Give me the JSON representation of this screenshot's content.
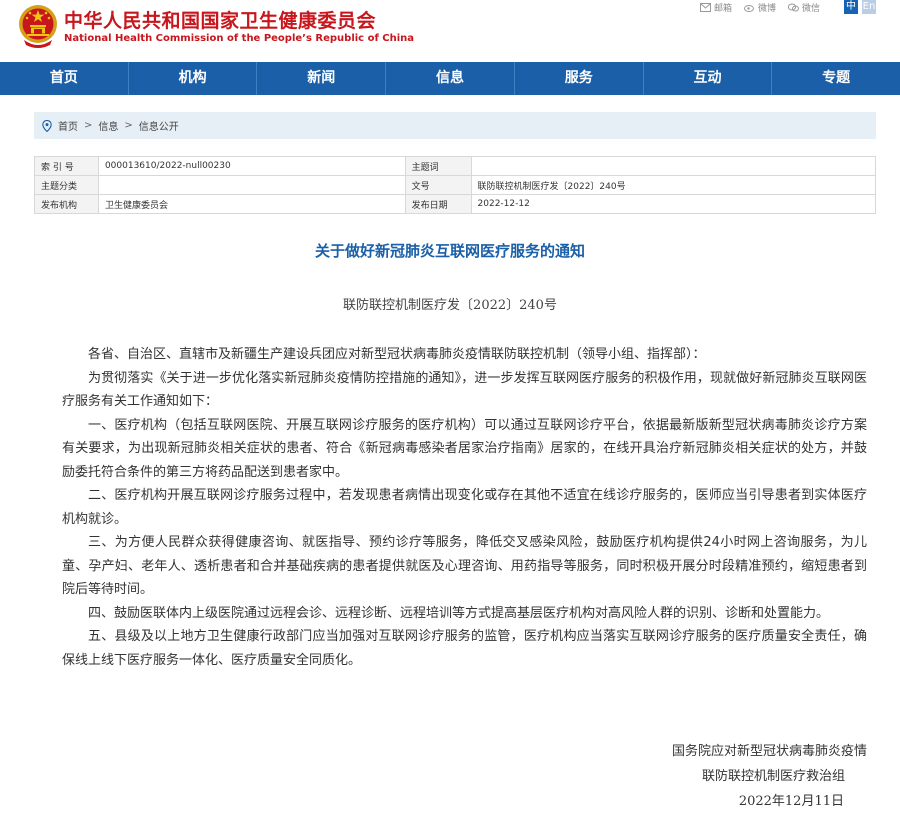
{
  "header": {
    "title_cn": "中华人民共和国国家卫生健康委员会",
    "title_en": "National Health Commission of the People’s Republic of China",
    "top_links": [
      {
        "icon": "mail-icon",
        "label": "邮箱"
      },
      {
        "icon": "weibo-icon",
        "label": "微博"
      },
      {
        "icon": "wechat-icon",
        "label": "微信"
      }
    ],
    "lang_zh": "中",
    "lang_en": "En"
  },
  "nav": {
    "items": [
      "首页",
      "机构",
      "新闻",
      "信息",
      "服务",
      "互动",
      "专题"
    ]
  },
  "breadcrumb": {
    "items": [
      "首页",
      "信息",
      "信息公开"
    ],
    "separator": ">"
  },
  "meta": {
    "index_label": "索 引 号",
    "index_value": "000013610/2022-null00230",
    "subject_label": "主题词",
    "subject_value": "",
    "category_label": "主题分类",
    "category_value": "",
    "docno_label": "文号",
    "docno_value": "联防联控机制医疗发〔2022〕240号",
    "issuer_label": "发布机构",
    "issuer_value": "卫生健康委员会",
    "date_label": "发布日期",
    "date_value": "2022-12-12"
  },
  "document": {
    "title": "关于做好新冠肺炎互联网医疗服务的通知",
    "number": "联防联控机制医疗发〔2022〕240号",
    "paragraphs": [
      "各省、自治区、直辖市及新疆生产建设兵团应对新型冠状病毒肺炎疫情联防联控机制（领导小组、指挥部）：",
      "为贯彻落实《关于进一步优化落实新冠肺炎疫情防控措施的通知》，进一步发挥互联网医疗服务的积极作用，现就做好新冠肺炎互联网医疗服务有关工作通知如下：",
      "一、医疗机构（包括互联网医院、开展互联网诊疗服务的医疗机构）可以通过互联网诊疗平台，依据最新版新型冠状病毒肺炎诊疗方案有关要求，为出现新冠肺炎相关症状的患者、符合《新冠病毒感染者居家治疗指南》居家的，在线开具治疗新冠肺炎相关症状的处方，并鼓励委托符合条件的第三方将药品配送到患者家中。",
      "二、医疗机构开展互联网诊疗服务过程中，若发现患者病情出现变化或存在其他不适宜在线诊疗服务的，医师应当引导患者到实体医疗机构就诊。",
      "三、为方便人民群众获得健康咨询、就医指导、预约诊疗等服务，降低交叉感染风险，鼓励医疗机构提供24小时网上咨询服务，为儿童、孕产妇、老年人、透析患者和合并基础疾病的患者提供就医及心理咨询、用药指导等服务，同时积极开展分时段精准预约，缩短患者到院后等待时间。",
      "四、鼓励医联体内上级医院通过远程会诊、远程诊断、远程培训等方式提高基层医疗机构对高风险人群的识别、诊断和处置能力。",
      "五、县级及以上地方卫生健康行政部门应当加强对互联网诊疗服务的监管，医疗机构应当落实互联网诊疗服务的医疗质量安全责任，确保线上线下医疗服务一体化、医疗质量安全同质化。"
    ],
    "signature_line1": "国务院应对新型冠状病毒肺炎疫情",
    "signature_line2": "联防联控机制医疗救治组",
    "signature_date": "2022年12月11日"
  },
  "colors": {
    "brand_red": "#c8161d",
    "nav_blue": "#1a5fa8",
    "title_blue": "#1a5fa8",
    "breadcrumb_bg": "#e6eef6"
  }
}
